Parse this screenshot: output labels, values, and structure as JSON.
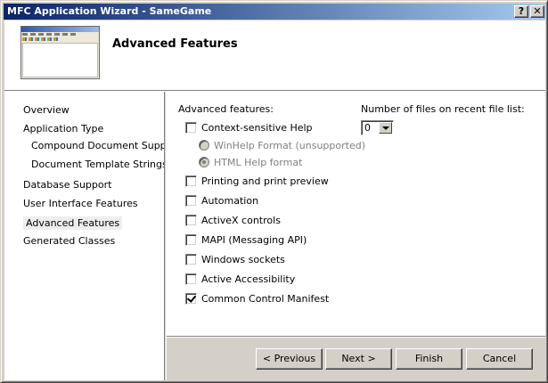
{
  "window": {
    "title": "MFC Application Wizard - SameGame",
    "help_glyph": "?",
    "close_glyph": "✕"
  },
  "header": {
    "title": "Advanced Features"
  },
  "nav": {
    "items": [
      {
        "label": "Overview"
      },
      {
        "label": "Application Type"
      },
      {
        "label": "Compound Document Support"
      },
      {
        "label": "Document Template Strings"
      },
      {
        "label": "Database Support"
      },
      {
        "label": "User Interface Features"
      },
      {
        "label": "Advanced Features"
      },
      {
        "label": "Generated Classes"
      }
    ],
    "active": "Advanced Features"
  },
  "content": {
    "section_label": "Advanced features:",
    "options": [
      {
        "label": "Context-sensitive Help",
        "checked": false
      },
      {
        "label": "Printing and print preview",
        "checked": false
      },
      {
        "label": "Automation",
        "checked": false
      },
      {
        "label": "ActiveX controls",
        "checked": false
      },
      {
        "label": "MAPI (Messaging API)",
        "checked": false
      },
      {
        "label": "Windows sockets",
        "checked": false
      },
      {
        "label": "Active Accessibility",
        "checked": false
      },
      {
        "label": "Common Control Manifest",
        "checked": true
      }
    ],
    "help_formats": [
      {
        "label": "WinHelp Format (unsupported)",
        "selected": false
      },
      {
        "label": "HTML Help format",
        "selected": true
      }
    ],
    "recent_files_label": "Number of files on recent file list:",
    "recent_files_value": "0"
  },
  "buttons": {
    "previous": "< Previous",
    "next": "Next >",
    "finish": "Finish",
    "cancel": "Cancel"
  }
}
